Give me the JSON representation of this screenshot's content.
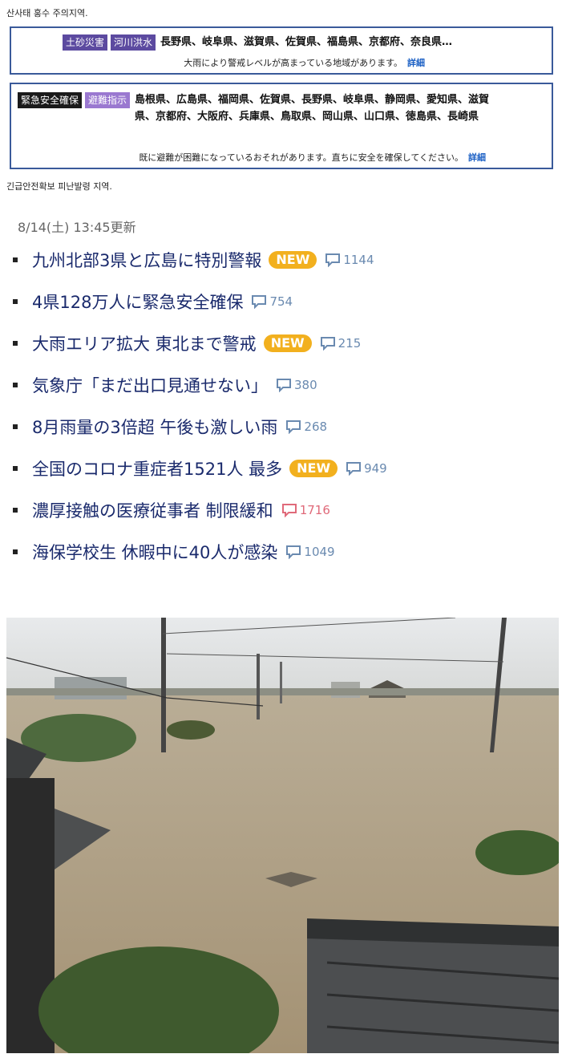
{
  "captions": {
    "top": "산사태  홍수 주의지역.",
    "middle": "긴급안전확보  피난발령 지역."
  },
  "warning_box": {
    "badges": [
      "土砂災害",
      "河川洪水"
    ],
    "regions": "長野県、岐阜県、滋賀県、佐賀県、福島県、京都府、奈良県…",
    "note": "大雨により警戒レベルが高まっている地域があります。",
    "link": "詳細"
  },
  "emergency_box": {
    "badges": [
      "緊急安全確保",
      "避難指示"
    ],
    "regions": "島根県、広島県、福岡県、佐賀県、長野県、岐阜県、静岡県、愛知県、滋賀県、京都府、大阪府、兵庫県、鳥取県、岡山県、山口県、徳島県、長崎県",
    "note": "既に避難が困難になっているおそれがあります。直ちに安全を確保してください。",
    "link": "詳細"
  },
  "news": {
    "updated": "8/14(土) 13:45更新",
    "new_label": "NEW",
    "items": [
      {
        "headline": "九州北部3県と広島に特別警報",
        "new": true,
        "comments": "1144",
        "hot": false
      },
      {
        "headline": "4県128万人に緊急安全確保",
        "new": false,
        "comments": "754",
        "hot": false
      },
      {
        "headline": "大雨エリア拡大 東北まで警戒",
        "new": true,
        "comments": "215",
        "hot": false
      },
      {
        "headline": "気象庁「まだ出口見通せない」",
        "new": false,
        "comments": "380",
        "hot": false
      },
      {
        "headline": "8月雨量の3倍超 午後も激しい雨",
        "new": false,
        "comments": "268",
        "hot": false
      },
      {
        "headline": "全国のコロナ重症者1521人 最多",
        "new": true,
        "comments": "949",
        "hot": false
      },
      {
        "headline": "濃厚接触の医療従事者 制限緩和",
        "new": false,
        "comments": "1716",
        "hot": true
      },
      {
        "headline": "海保学校生 休暇中に40人が感染",
        "new": false,
        "comments": "1049",
        "hot": false
      }
    ]
  },
  "colors": {
    "headline": "#1a2a6c",
    "new_badge": "#f2b01e",
    "comment": "#6a8ab0",
    "comment_hot": "#e06a7a",
    "box_border": "#3a5a9a"
  },
  "photo_icon": "flooded-town-photo"
}
